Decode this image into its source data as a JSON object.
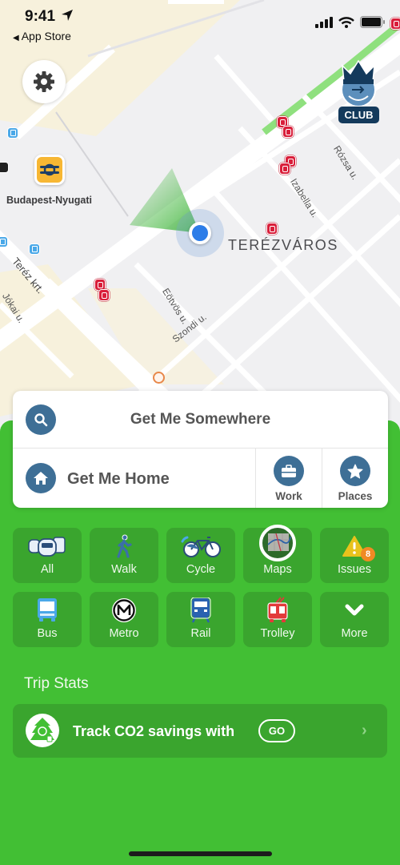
{
  "status_bar": {
    "time": "9:41",
    "back_app": "App Store",
    "back_arrow": "◀"
  },
  "map": {
    "district_label": "TERÉZVÁROS",
    "station_label": "Budapest-Nyugati",
    "streets": [
      "Teréz krt.",
      "Jókai u.",
      "Eötvös u.",
      "Szondi u.",
      "Izabella u.",
      "Rózsa u."
    ],
    "club_badge": "CLUB"
  },
  "search": {
    "get_me_somewhere": "Get Me Somewhere",
    "get_me_home": "Get Me Home",
    "work": "Work",
    "places": "Places"
  },
  "modes": [
    {
      "label": "All",
      "icon": "all-transit-icon"
    },
    {
      "label": "Walk",
      "icon": "walk-icon"
    },
    {
      "label": "Cycle",
      "icon": "bicycle-icon"
    },
    {
      "label": "Maps",
      "icon": "map-icon"
    },
    {
      "label": "Issues",
      "icon": "warning-icon",
      "badge": "8"
    },
    {
      "label": "Bus",
      "icon": "bus-icon"
    },
    {
      "label": "Metro",
      "icon": "metro-icon"
    },
    {
      "label": "Rail",
      "icon": "train-icon"
    },
    {
      "label": "Trolley",
      "icon": "trolleybus-icon"
    },
    {
      "label": "More",
      "icon": "chevron-down-icon"
    }
  ],
  "trip_stats": {
    "title": "Trip Stats",
    "track_text": "Track CO2 savings with",
    "go_label": "GO",
    "chevron": "›"
  },
  "colors": {
    "brand_green": "#42bf34",
    "tile_green": "#3aa52e",
    "icon_blue": "#3e6f96",
    "tram_red": "#d91e3a",
    "location_blue": "#2d7de8",
    "badge_orange": "#f08a24"
  }
}
